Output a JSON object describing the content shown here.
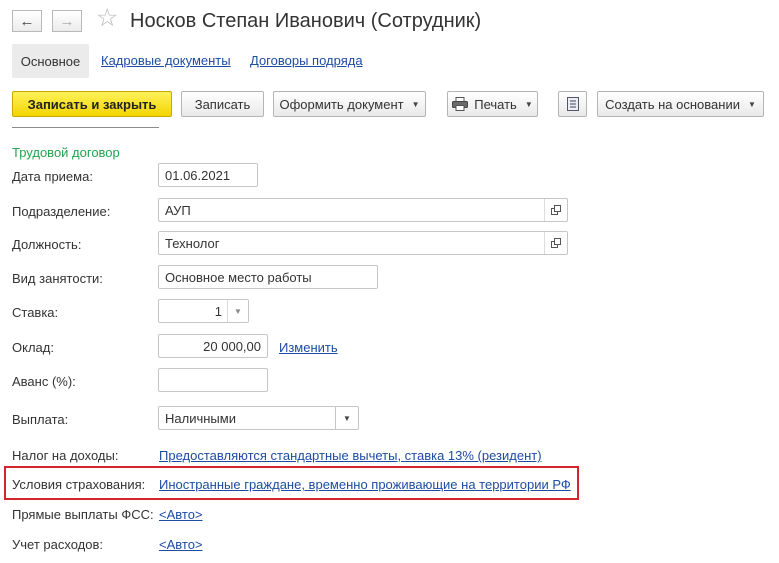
{
  "header": {
    "title": "Носков Степан Иванович (Сотрудник)",
    "back_icon": "arrow-left-icon",
    "forward_icon": "arrow-right-icon",
    "favorite_icon": "star-icon"
  },
  "tabs": [
    {
      "label": "Основное",
      "active": true
    },
    {
      "label": "Кадровые документы",
      "active": false
    },
    {
      "label": "Договоры подряда",
      "active": false
    }
  ],
  "toolbar": {
    "save_close_label": "Записать и закрыть",
    "save_label": "Записать",
    "create_document_label": "Оформить документ",
    "print_label": "Печать",
    "create_based_label": "Создать на основании",
    "print_icon": "printer-icon",
    "list_icon": "list-icon"
  },
  "form": {
    "section_title": "Трудовой договор",
    "hire_date": {
      "label": "Дата приема:",
      "value": "01.06.2021"
    },
    "department": {
      "label": "Подразделение:",
      "value": "АУП"
    },
    "position": {
      "label": "Должность:",
      "value": "Технолог"
    },
    "employment_type": {
      "label": "Вид занятости:",
      "value": "Основное место работы"
    },
    "rate": {
      "label": "Ставка:",
      "value": "1"
    },
    "salary": {
      "label": "Оклад:",
      "value": "20 000,00",
      "change_link": "Изменить"
    },
    "advance": {
      "label": "Аванс (%):",
      "value": ""
    },
    "payment": {
      "label": "Выплата:",
      "value": "Наличными"
    },
    "income_tax": {
      "label": "Налог на доходы:",
      "value": "Предоставляются стандартные вычеты, ставка 13% (резидент)"
    },
    "insurance": {
      "label": "Условия страхования:",
      "value": "Иностранные граждане, временно проживающие на территории РФ"
    },
    "fss_payments": {
      "label": "Прямые выплаты ФСС:",
      "value": "<Авто>"
    },
    "expense_accounting": {
      "label": "Учет расходов:",
      "value": "<Авто>"
    }
  },
  "colors": {
    "accent_yellow": "#f3d400",
    "link_blue": "#1d4ca3",
    "section_green": "#22a34f",
    "highlight_red": "#d2262c"
  }
}
